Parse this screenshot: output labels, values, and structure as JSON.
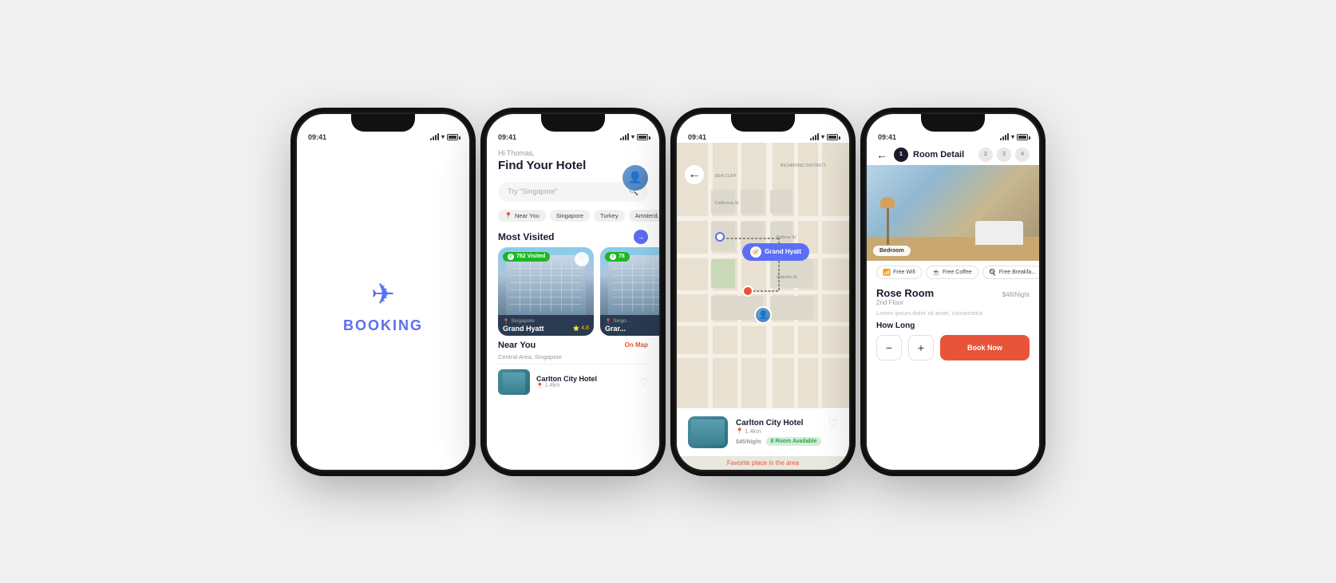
{
  "phones": [
    {
      "id": "splash",
      "statusBar": {
        "time": "09:41"
      },
      "content": {
        "type": "splash",
        "logo": "✈",
        "brand": "BOOKING"
      }
    },
    {
      "id": "hotel-list",
      "statusBar": {
        "time": "09:41"
      },
      "content": {
        "type": "hotel-list",
        "greeting": "Hi Thomas,",
        "title": "Find Your Hotel",
        "searchPlaceholder": "Try \"Singapore\"",
        "filters": [
          "Near You",
          "Singapore",
          "Turkey",
          "Amsterd..."
        ],
        "mostVisited": {
          "label": "Most Visited",
          "arrowLabel": "→"
        },
        "hotelCards": [
          {
            "visitedCount": "782 Visited",
            "location": "Singapore",
            "name": "Grand Hyatt",
            "rating": "4.8",
            "hasHeart": true
          },
          {
            "visitedCount": "78",
            "location": "Singo...",
            "name": "Grar...",
            "rating": "",
            "hasHeart": false
          }
        ],
        "nearYou": {
          "label": "Near You",
          "subtitle": "Central Area, Singapore",
          "onMapLabel": "On Map"
        },
        "nearHotels": [
          {
            "name": "Carlton City Hotel",
            "distance": "1.4km"
          }
        ]
      }
    },
    {
      "id": "map",
      "statusBar": {
        "time": "09:41"
      },
      "content": {
        "type": "map",
        "backLabel": "←",
        "mapPin": "Grand Hyatt",
        "bottomCard": {
          "name": "Carlton City Hotel",
          "distance": "1.4km",
          "price": "$45",
          "priceUnit": "/Night",
          "rooms": "8 Room Available",
          "favoriteText": "Favorite place in the area"
        }
      }
    },
    {
      "id": "room-detail",
      "statusBar": {
        "time": "09:41"
      },
      "content": {
        "type": "room-detail",
        "backLabel": "←",
        "title": "Room Detail",
        "steps": [
          "1",
          "2",
          "3",
          "4"
        ],
        "activeStep": 0,
        "roomImageLabel": "Bedroom",
        "amenities": [
          {
            "icon": "📶",
            "label": "Free Wifi"
          },
          {
            "icon": "☕",
            "label": "Free Coffee"
          },
          {
            "icon": "🍳",
            "label": "Free Breakfa..."
          }
        ],
        "roomName": "Rose Room",
        "price": "$48",
        "priceUnit": "/Night",
        "floor": "2nd Floor",
        "description": "Lorem ipsum dolor sit amet, consectetur",
        "howLong": "How Long",
        "minusLabel": "−",
        "plusLabel": "+",
        "bookNowLabel": "Book Now"
      }
    }
  ]
}
